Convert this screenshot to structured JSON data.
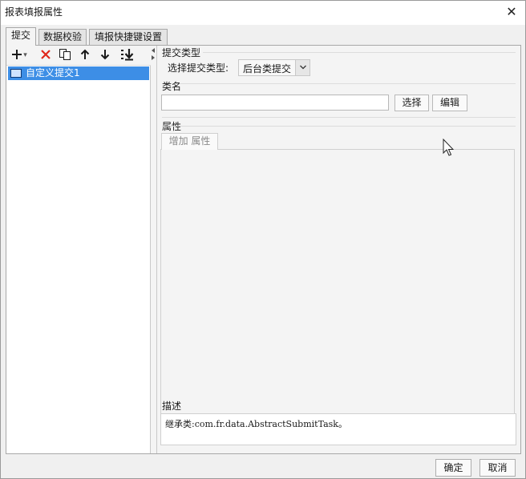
{
  "window": {
    "title": "报表填报属性",
    "close_glyph": "✕"
  },
  "tabs": [
    {
      "label": "提交",
      "active": true
    },
    {
      "label": "数据校验",
      "active": false
    },
    {
      "label": "填报快捷键设置",
      "active": false
    }
  ],
  "toolbar": {
    "icons": [
      "add-icon",
      "delete-icon",
      "copy-icon",
      "move-up-icon",
      "move-down-icon",
      "move-bottom-icon"
    ],
    "add_dropdown_glyph": "▾"
  },
  "tree": {
    "items": [
      {
        "label": "自定义提交1",
        "selected": true
      }
    ]
  },
  "submit_type": {
    "section_label": "提交类型",
    "field_label": "选择提交类型:",
    "selected": "后台类提交"
  },
  "class_name": {
    "section_label": "类名",
    "value": "",
    "choose_label": "选择",
    "edit_label": "编辑"
  },
  "properties": {
    "section_label": "属性",
    "add_label": "增加 属性"
  },
  "description": {
    "section_label": "描述",
    "text": "继承类:com.fr.data.AbstractSubmitTask。"
  },
  "footer": {
    "ok_label": "确定",
    "cancel_label": "取消"
  },
  "colors": {
    "selection": "#3d8ee6",
    "delete_red": "#e0271a",
    "panel_bg": "#f4f4f4"
  }
}
